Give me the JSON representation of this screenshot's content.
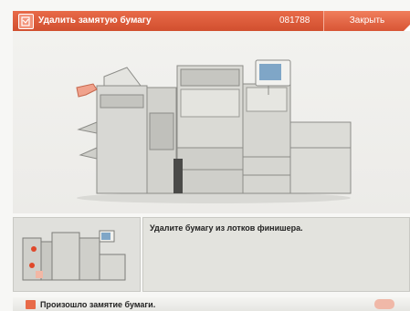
{
  "header": {
    "title": "Удалить замятую бумагу",
    "code": "081788",
    "close_label": "Закрыть"
  },
  "instruction": "Удалите бумагу из лотков финишера.",
  "status": {
    "message": "Произошло замятие бумаги."
  },
  "colors": {
    "header": "#d95a39",
    "panel": "#e3e3de",
    "jam_marker": "#e0482a"
  },
  "icons": {
    "header": "paper-jam-icon",
    "status": "paper-jam-icon",
    "pointer": "hand-pointer-icon"
  }
}
